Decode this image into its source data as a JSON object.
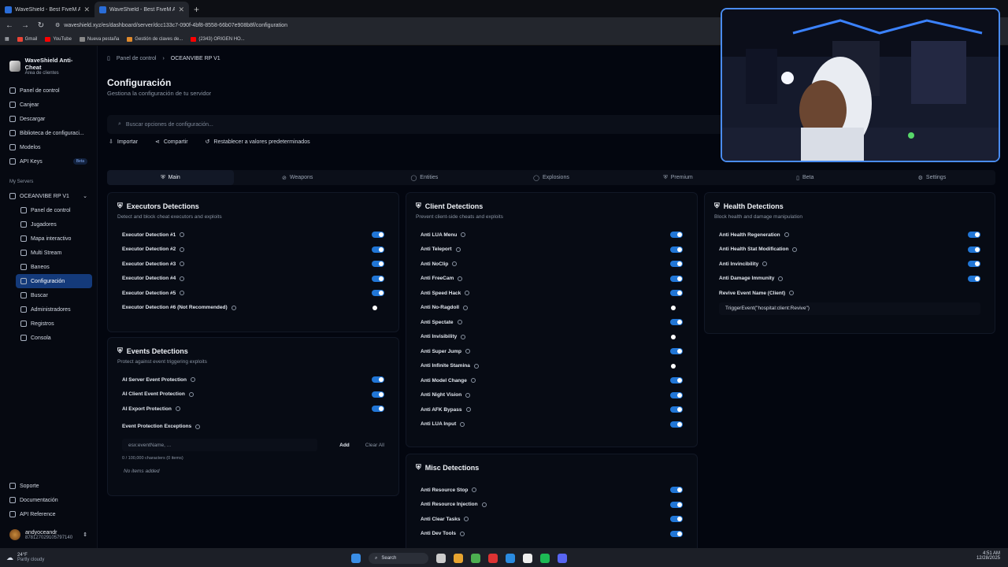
{
  "browser": {
    "tabs": [
      {
        "title": "WaveShield - Best FiveM Antic"
      },
      {
        "title": "WaveShield - Best FiveM Antic"
      }
    ],
    "url": "waveshield.xyz/es/dashboard/server/dcc133c7-090f-4bf8-8558-66b07e908b8f/configuration",
    "bookmarks": [
      "Gmail",
      "YouTube",
      "Nueva pestaña",
      "Gestión de claves de...",
      "(2343) ORIGEN HO..."
    ]
  },
  "sidebar": {
    "brand": "WaveShield Anti-Cheat",
    "brand_sub": "Área de clientes",
    "items": [
      "Panel de control",
      "Canjear",
      "Descargar",
      "Biblioteca de configuraci...",
      "Modelos",
      "API Keys"
    ],
    "api_badge": "Beta",
    "section": "My Servers",
    "server": "OCEANVIBE RP V1",
    "server_items": [
      "Panel de control",
      "Jugadores",
      "Mapa interactivo",
      "Multi Stream",
      "Baneos",
      "Configuración",
      "Buscar",
      "Administradores",
      "Registros",
      "Consola"
    ],
    "footer": [
      "Soporte",
      "Documentación",
      "API Reference"
    ],
    "user": {
      "name": "andyoceandr",
      "id": "878127029105797140"
    }
  },
  "main": {
    "crumb1": "Panel de control",
    "crumb2": "OCEANVIBE RP V1",
    "title": "Configuración",
    "subtitle": "Gestiona la configuración de tu servidor",
    "search_placeholder": "Buscar opciones de configuración...",
    "actions": [
      "Importar",
      "Compartir",
      "Restablecer a valores predeterminados"
    ],
    "tabs": [
      "Main",
      "Weapons",
      "Entities",
      "Explosions",
      "Premium",
      "Beta",
      "Settings"
    ]
  },
  "executors": {
    "title": "Executors Detections",
    "desc": "Detect and block cheat executors and exploits",
    "rows": [
      {
        "l": "Executor Detection #1",
        "on": true
      },
      {
        "l": "Executor Detection #2",
        "on": true
      },
      {
        "l": "Executor Detection #3",
        "on": true
      },
      {
        "l": "Executor Detection #4",
        "on": true
      },
      {
        "l": "Executor Detection #5",
        "on": true
      },
      {
        "l": "Executor Detection #6 (Not Recommended)",
        "on": false
      }
    ]
  },
  "events": {
    "title": "Events Detections",
    "desc": "Protect against event triggering exploits",
    "rows": [
      {
        "l": "AI Server Event Protection",
        "on": true
      },
      {
        "l": "AI Client Event Protection",
        "on": true
      },
      {
        "l": "AI Export Protection",
        "on": true
      }
    ],
    "exc_label": "Event Protection Exceptions",
    "exc_placeholder": "esx:eventName, ...",
    "add": "Add",
    "clear": "Clear All",
    "counter": "0 / 100,000 characters (0 items)",
    "empty": "No items added"
  },
  "client": {
    "title": "Client Detections",
    "desc": "Prevent client-side cheats and exploits",
    "rows": [
      {
        "l": "Anti LUA Menu",
        "on": true
      },
      {
        "l": "Anti Teleport",
        "on": true
      },
      {
        "l": "Anti NoClip",
        "on": true
      },
      {
        "l": "Anti FreeCam",
        "on": true
      },
      {
        "l": "Anti Speed Hack",
        "on": true
      },
      {
        "l": "Anti No-Ragdoll",
        "on": false
      },
      {
        "l": "Anti Spectate",
        "on": true
      },
      {
        "l": "Anti Invisibility",
        "on": false
      },
      {
        "l": "Anti Super Jump",
        "on": true
      },
      {
        "l": "Anti Infinite Stamina",
        "on": false
      },
      {
        "l": "Anti Model Change",
        "on": true
      },
      {
        "l": "Anti Night Vision",
        "on": true
      },
      {
        "l": "Anti AFK Bypass",
        "on": true
      },
      {
        "l": "Anti LUA Input",
        "on": true
      }
    ]
  },
  "misc": {
    "title": "Misc Detections",
    "rows": [
      {
        "l": "Anti Resource Stop",
        "on": true
      },
      {
        "l": "Anti Resource Injection",
        "on": true
      },
      {
        "l": "Anti Clear Tasks",
        "on": true
      },
      {
        "l": "Anti Dev Tools",
        "on": true
      }
    ]
  },
  "health": {
    "title": "Health Detections",
    "desc": "Block health and damage manipulation",
    "rows": [
      {
        "l": "Anti Health Regeneration",
        "on": true
      },
      {
        "l": "Anti Health Stat Modification",
        "on": true
      },
      {
        "l": "Anti Invincibility",
        "on": true
      },
      {
        "l": "Anti Damage Immunity",
        "on": true
      }
    ],
    "revive_label": "Revive Event Name (Client)",
    "revive_value": "TriggerEvent(\"hospital:client:Revive\")"
  },
  "taskbar": {
    "temp": "24°F",
    "weather": "Partly cloudy",
    "search": "Search",
    "time": "4:51 AM",
    "date": "12/28/2025"
  }
}
